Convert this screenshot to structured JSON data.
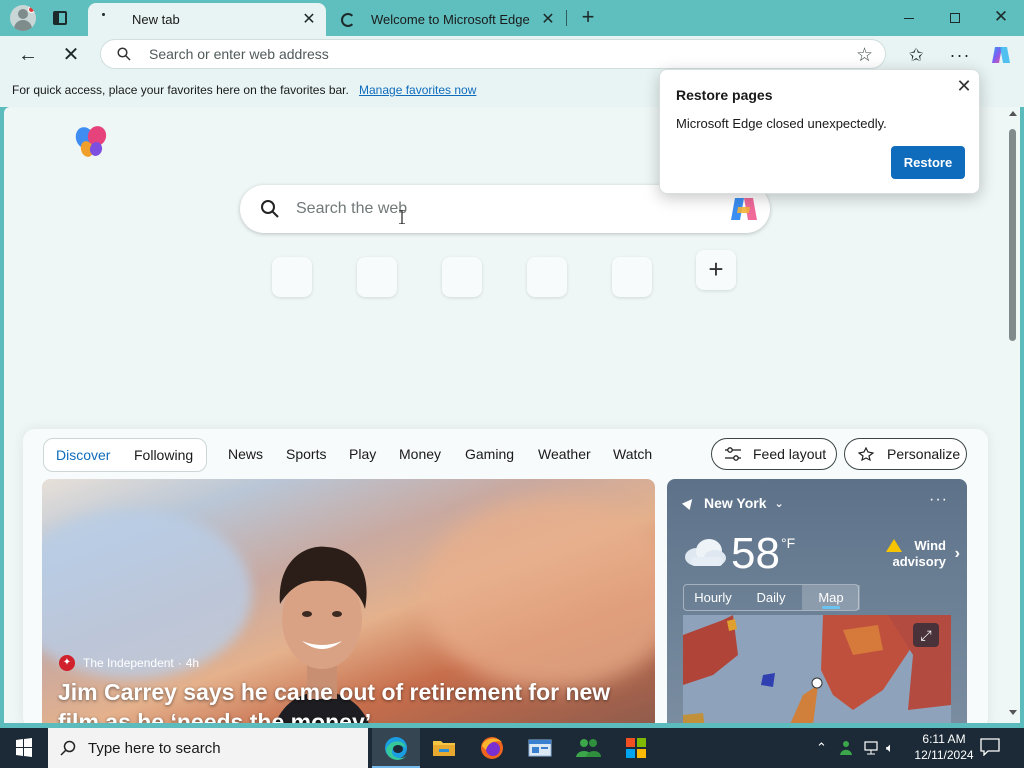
{
  "window": {
    "tabs": [
      {
        "label": "New tab",
        "active": true
      },
      {
        "label": "Welcome to Microsoft Edge",
        "active": false
      }
    ]
  },
  "toolbar": {
    "address_placeholder": "Search or enter web address"
  },
  "favorites_bar": {
    "message": "For quick access, place your favorites here on the favorites bar.",
    "manage_link": "Manage favorites now"
  },
  "newtab": {
    "search_placeholder": "Search the web"
  },
  "popup": {
    "title": "Restore pages",
    "message": "Microsoft Edge closed unexpectedly.",
    "button": "Restore"
  },
  "feed": {
    "toggle": [
      "Discover",
      "Following"
    ],
    "nav": [
      "News",
      "Sports",
      "Play",
      "Money",
      "Gaming",
      "Weather",
      "Watch"
    ],
    "feed_layout_label": "Feed layout",
    "personalize_label": "Personalize",
    "hero": {
      "source": "The Independent",
      "age": "4h",
      "headline": "Jim Carrey says he came out of retirement for new film as he ‘needs the money’"
    },
    "weather": {
      "location": "New York",
      "temperature": "58",
      "unit": "°F",
      "advisory_line1": "Wind",
      "advisory_line2": "advisory",
      "tabs": [
        "Hourly",
        "Daily",
        "Map"
      ],
      "selected_tab": "Map"
    }
  },
  "taskbar": {
    "search_placeholder": "Type here to search",
    "time": "6:11 AM",
    "date": "12/11/2024"
  },
  "colors": {
    "accent": "#0f6cbd",
    "frame": "#5fbfbf",
    "taskbar": "#1b2a36"
  }
}
